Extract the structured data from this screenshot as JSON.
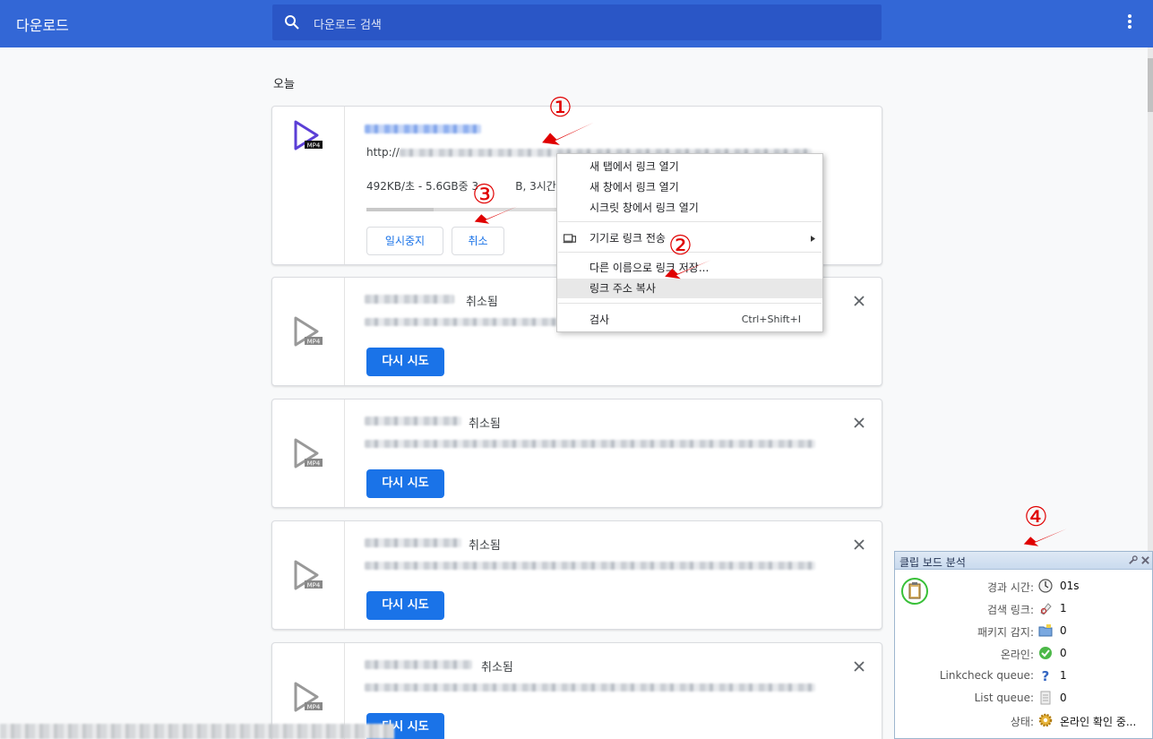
{
  "header": {
    "title": "다운로드",
    "search_placeholder": "다운로드 검색"
  },
  "section": {
    "title": "오늘"
  },
  "active_download": {
    "url_prefix": "http://",
    "progress_text": "492KB/초 - 5.6GB중 3",
    "progress_text_tail": "B, 3시간 남",
    "progress_fraction": 0.35,
    "pause_label": "일시중지",
    "cancel_label": "취소"
  },
  "file_badge": "MP4",
  "cancelled_items": [
    {
      "status": "취소됨",
      "retry_label": "다시 시도"
    },
    {
      "status": "취소됨",
      "retry_label": "다시 시도"
    },
    {
      "status": "취소됨",
      "retry_label": "다시 시도"
    },
    {
      "status": "취소됨",
      "retry_label": "다시 시도"
    }
  ],
  "context_menu": {
    "items": [
      "새 탭에서 링크 열기",
      "새 창에서 링크 열기",
      "시크릿 창에서 링크 열기",
      "기기로 링크 전송",
      "다른 이름으로 링크 저장...",
      "링크 주소 복사",
      "검사"
    ],
    "shortcut": "Ctrl+Shift+I",
    "highlighted": "링크 주소 복사"
  },
  "annotations": [
    "①",
    "②",
    "③",
    "④"
  ],
  "annotation_color": "#e00000",
  "clipboard_panel": {
    "title": "클립 보드 분석",
    "rows": [
      {
        "label": "경과 시간:",
        "value": "01s",
        "icon": "clock-icon"
      },
      {
        "label": "검색 링크:",
        "value": "1",
        "icon": "link-search-icon"
      },
      {
        "label": "패키지 감지:",
        "value": "0",
        "icon": "folder-icon"
      },
      {
        "label": "온라인:",
        "value": "0",
        "icon": "check-icon"
      },
      {
        "label": "Linkcheck queue:",
        "value": "1",
        "icon": "question-icon"
      },
      {
        "label": "List queue:",
        "value": "0",
        "icon": "list-icon"
      },
      {
        "label": "상태:",
        "value": "온라인 확인 중...",
        "icon": "gear-icon"
      }
    ]
  },
  "colors": {
    "header": "#3367d6",
    "accent": "#1a73e8",
    "page_bg": "#f8f9fa"
  }
}
